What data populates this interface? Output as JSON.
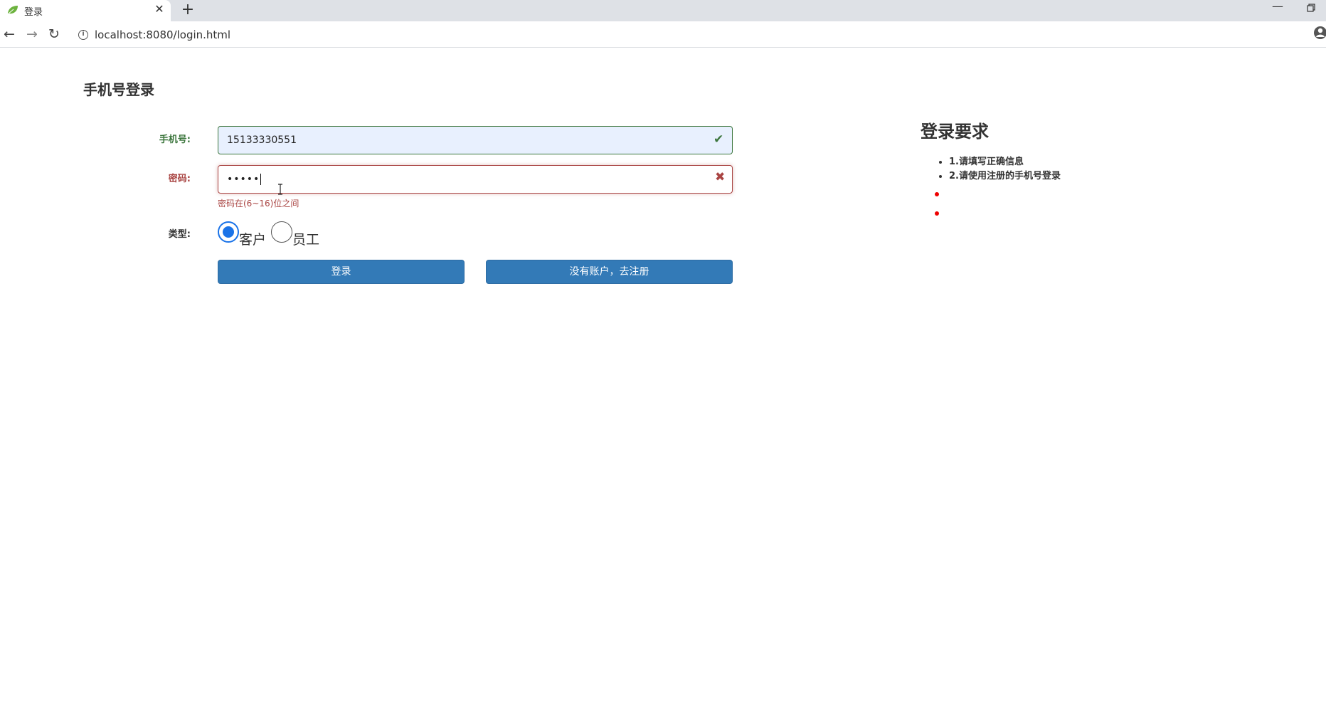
{
  "browser": {
    "tab_title": "登录",
    "tab_close": "✕",
    "new_tab": "+",
    "minimize": "—",
    "url": "localhost:8080/login.html",
    "info": "i",
    "back": "←",
    "forward": "→",
    "reload": "↻",
    "star": "☆"
  },
  "page": {
    "heading": "手机号登录",
    "phone": {
      "label": "手机号:",
      "value": "15133330551",
      "status": "valid",
      "status_icon": "✔"
    },
    "password": {
      "label": "密码:",
      "value": "•••••",
      "status": "invalid",
      "status_icon": "✖",
      "help": "密码在(6~16)位之间"
    },
    "type": {
      "label": "类型:",
      "options": [
        {
          "label": "客户",
          "checked": true
        },
        {
          "label": "员工",
          "checked": false
        }
      ]
    },
    "buttons": {
      "login": "登录",
      "register": "没有账户，去注册"
    }
  },
  "requirements": {
    "title": "登录要求",
    "items": [
      "1.请填写正确信息",
      "2.请使用注册的手机号登录"
    ],
    "error_dot_color": "#e00000"
  },
  "colors": {
    "success": "#3c763d",
    "error": "#a94442",
    "primary": "#337ab7"
  }
}
